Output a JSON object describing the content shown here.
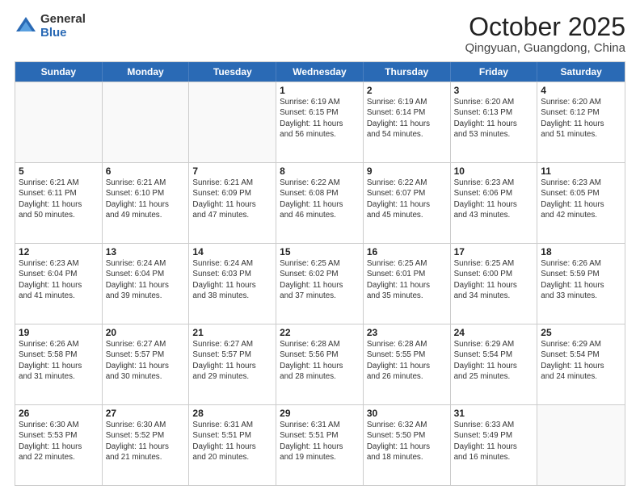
{
  "logo": {
    "general": "General",
    "blue": "Blue"
  },
  "title": "October 2025",
  "subtitle": "Qingyuan, Guangdong, China",
  "days": [
    "Sunday",
    "Monday",
    "Tuesday",
    "Wednesday",
    "Thursday",
    "Friday",
    "Saturday"
  ],
  "weeks": [
    [
      {
        "day": "",
        "info": ""
      },
      {
        "day": "",
        "info": ""
      },
      {
        "day": "",
        "info": ""
      },
      {
        "day": "1",
        "info": "Sunrise: 6:19 AM\nSunset: 6:15 PM\nDaylight: 11 hours\nand 56 minutes."
      },
      {
        "day": "2",
        "info": "Sunrise: 6:19 AM\nSunset: 6:14 PM\nDaylight: 11 hours\nand 54 minutes."
      },
      {
        "day": "3",
        "info": "Sunrise: 6:20 AM\nSunset: 6:13 PM\nDaylight: 11 hours\nand 53 minutes."
      },
      {
        "day": "4",
        "info": "Sunrise: 6:20 AM\nSunset: 6:12 PM\nDaylight: 11 hours\nand 51 minutes."
      }
    ],
    [
      {
        "day": "5",
        "info": "Sunrise: 6:21 AM\nSunset: 6:11 PM\nDaylight: 11 hours\nand 50 minutes."
      },
      {
        "day": "6",
        "info": "Sunrise: 6:21 AM\nSunset: 6:10 PM\nDaylight: 11 hours\nand 49 minutes."
      },
      {
        "day": "7",
        "info": "Sunrise: 6:21 AM\nSunset: 6:09 PM\nDaylight: 11 hours\nand 47 minutes."
      },
      {
        "day": "8",
        "info": "Sunrise: 6:22 AM\nSunset: 6:08 PM\nDaylight: 11 hours\nand 46 minutes."
      },
      {
        "day": "9",
        "info": "Sunrise: 6:22 AM\nSunset: 6:07 PM\nDaylight: 11 hours\nand 45 minutes."
      },
      {
        "day": "10",
        "info": "Sunrise: 6:23 AM\nSunset: 6:06 PM\nDaylight: 11 hours\nand 43 minutes."
      },
      {
        "day": "11",
        "info": "Sunrise: 6:23 AM\nSunset: 6:05 PM\nDaylight: 11 hours\nand 42 minutes."
      }
    ],
    [
      {
        "day": "12",
        "info": "Sunrise: 6:23 AM\nSunset: 6:04 PM\nDaylight: 11 hours\nand 41 minutes."
      },
      {
        "day": "13",
        "info": "Sunrise: 6:24 AM\nSunset: 6:04 PM\nDaylight: 11 hours\nand 39 minutes."
      },
      {
        "day": "14",
        "info": "Sunrise: 6:24 AM\nSunset: 6:03 PM\nDaylight: 11 hours\nand 38 minutes."
      },
      {
        "day": "15",
        "info": "Sunrise: 6:25 AM\nSunset: 6:02 PM\nDaylight: 11 hours\nand 37 minutes."
      },
      {
        "day": "16",
        "info": "Sunrise: 6:25 AM\nSunset: 6:01 PM\nDaylight: 11 hours\nand 35 minutes."
      },
      {
        "day": "17",
        "info": "Sunrise: 6:25 AM\nSunset: 6:00 PM\nDaylight: 11 hours\nand 34 minutes."
      },
      {
        "day": "18",
        "info": "Sunrise: 6:26 AM\nSunset: 5:59 PM\nDaylight: 11 hours\nand 33 minutes."
      }
    ],
    [
      {
        "day": "19",
        "info": "Sunrise: 6:26 AM\nSunset: 5:58 PM\nDaylight: 11 hours\nand 31 minutes."
      },
      {
        "day": "20",
        "info": "Sunrise: 6:27 AM\nSunset: 5:57 PM\nDaylight: 11 hours\nand 30 minutes."
      },
      {
        "day": "21",
        "info": "Sunrise: 6:27 AM\nSunset: 5:57 PM\nDaylight: 11 hours\nand 29 minutes."
      },
      {
        "day": "22",
        "info": "Sunrise: 6:28 AM\nSunset: 5:56 PM\nDaylight: 11 hours\nand 28 minutes."
      },
      {
        "day": "23",
        "info": "Sunrise: 6:28 AM\nSunset: 5:55 PM\nDaylight: 11 hours\nand 26 minutes."
      },
      {
        "day": "24",
        "info": "Sunrise: 6:29 AM\nSunset: 5:54 PM\nDaylight: 11 hours\nand 25 minutes."
      },
      {
        "day": "25",
        "info": "Sunrise: 6:29 AM\nSunset: 5:54 PM\nDaylight: 11 hours\nand 24 minutes."
      }
    ],
    [
      {
        "day": "26",
        "info": "Sunrise: 6:30 AM\nSunset: 5:53 PM\nDaylight: 11 hours\nand 22 minutes."
      },
      {
        "day": "27",
        "info": "Sunrise: 6:30 AM\nSunset: 5:52 PM\nDaylight: 11 hours\nand 21 minutes."
      },
      {
        "day": "28",
        "info": "Sunrise: 6:31 AM\nSunset: 5:51 PM\nDaylight: 11 hours\nand 20 minutes."
      },
      {
        "day": "29",
        "info": "Sunrise: 6:31 AM\nSunset: 5:51 PM\nDaylight: 11 hours\nand 19 minutes."
      },
      {
        "day": "30",
        "info": "Sunrise: 6:32 AM\nSunset: 5:50 PM\nDaylight: 11 hours\nand 18 minutes."
      },
      {
        "day": "31",
        "info": "Sunrise: 6:33 AM\nSunset: 5:49 PM\nDaylight: 11 hours\nand 16 minutes."
      },
      {
        "day": "",
        "info": ""
      }
    ]
  ]
}
